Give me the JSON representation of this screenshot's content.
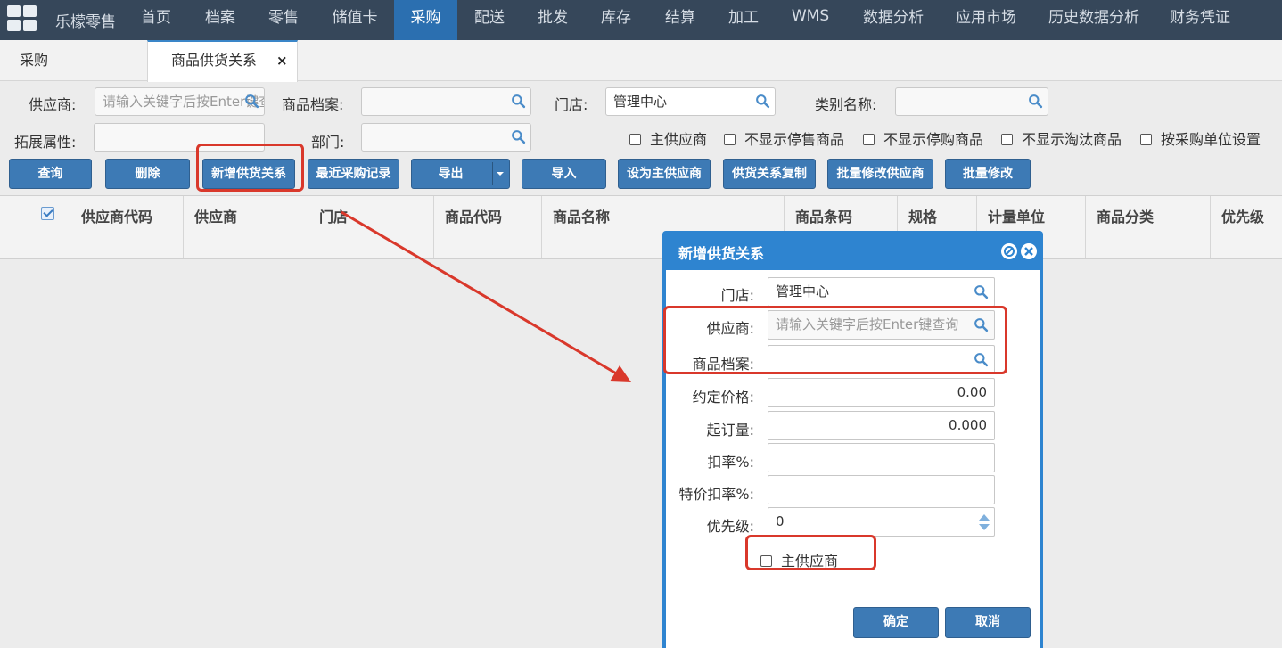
{
  "nav": {
    "brand": "乐檬零售",
    "items": [
      {
        "label": "首页"
      },
      {
        "label": "档案"
      },
      {
        "label": "零售"
      },
      {
        "label": "储值卡"
      },
      {
        "label": "采购"
      },
      {
        "label": "配送"
      },
      {
        "label": "批发"
      },
      {
        "label": "库存"
      },
      {
        "label": "结算"
      },
      {
        "label": "加工"
      },
      {
        "label": "WMS"
      },
      {
        "label": "数据分析"
      },
      {
        "label": "应用市场"
      },
      {
        "label": "历史数据分析"
      },
      {
        "label": "财务凭证"
      }
    ],
    "active": "采购"
  },
  "tabs": [
    {
      "label": "采购"
    },
    {
      "label": "商品供货关系",
      "close": "×"
    }
  ],
  "filters": {
    "supplier_label": "供应商:",
    "supplier_placeholder": "请输入关键字后按Enter键查询",
    "product_label": "商品档案:",
    "store_label": "门店:",
    "store_value": "管理中心",
    "category_label": "类别名称:",
    "ext_label": "拓展属性:",
    "dept_label": "部门:",
    "checkboxes": [
      {
        "label": "主供应商",
        "checked": false
      },
      {
        "label": "不显示停售商品",
        "checked": false
      },
      {
        "label": "不显示停购商品",
        "checked": false
      },
      {
        "label": "不显示淘汰商品",
        "checked": false
      },
      {
        "label": "按采购单位设置",
        "checked": false
      }
    ]
  },
  "toolbar": {
    "query": "查询",
    "delete": "删除",
    "add_relation": "新增供货关系",
    "recent_purchase": "最近采购记录",
    "export": "导出",
    "import": "导入",
    "set_main_supplier": "设为主供应商",
    "copy_relation": "供货关系复制",
    "batch_modify_supplier": "批量修改供应商",
    "batch_modify": "批量修改"
  },
  "grid": {
    "columns": [
      "供应商代码",
      "供应商",
      "门店",
      "商品代码",
      "商品名称",
      "商品条码",
      "规格",
      "计量单位",
      "商品分类",
      "优先级"
    ]
  },
  "dialog": {
    "title": "新增供货关系",
    "store_label": "门店:",
    "store_value": "管理中心",
    "supplier_label": "供应商:",
    "supplier_placeholder": "请输入关键字后按Enter键查询",
    "product_label": "商品档案:",
    "price_label": "约定价格:",
    "price_value": "0.00",
    "moq_label": "起订量:",
    "moq_value": "0.000",
    "discount_label": "扣率%:",
    "special_discount_label": "特价扣率%:",
    "priority_label": "优先级:",
    "priority_value": "0",
    "main_supplier_label": "主供应商",
    "main_supplier_checked": false,
    "confirm": "确定",
    "cancel": "取消"
  },
  "colors": {
    "nav_bg": "#36475a",
    "nav_active": "#2b6fb0",
    "button": "#3d7ab5",
    "dialog_header": "#2e84d0",
    "annotation": "#d9382b"
  }
}
